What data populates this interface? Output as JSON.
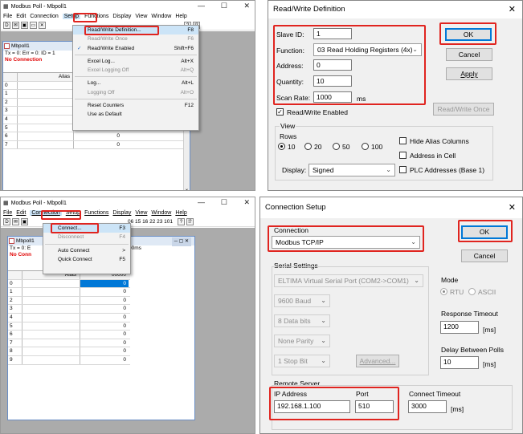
{
  "app": {
    "title": "Modbus Poll - Mbpoll1",
    "menu": [
      "File",
      "Edit",
      "Connection",
      "Setup",
      "Functions",
      "Display",
      "View",
      "Window",
      "Help"
    ],
    "minimize": "—",
    "maximize": "☐",
    "close": "✕",
    "toolbar": [
      "D",
      "✉",
      "▣",
      "✕",
      "▭",
      "06",
      "15",
      "16",
      "22",
      "23",
      "101",
      "?",
      "⁉"
    ],
    "toolbar_text": "06  15  16  22  23  101"
  },
  "child": {
    "title": "Mbpoll1",
    "status_tl": "Tx = 0: Err = 0: ID = 1",
    "status_bl": "Tx = 0: E",
    "status_ms": "00ms",
    "no_connection": "No Connection",
    "no_connection_short": "No Conn",
    "alias_header": "Alias",
    "value_header": "00000",
    "rows": [
      "0",
      "1",
      "2",
      "3",
      "4",
      "5",
      "6",
      "7",
      "8",
      "9"
    ],
    "values": [
      "0",
      "0",
      "0",
      "0",
      "0",
      "0",
      "0",
      "0",
      "0",
      "0"
    ]
  },
  "setup_menu": {
    "items": [
      {
        "label": "Read/Write Definition...",
        "shortcut": "F8"
      },
      {
        "label": "Read/Write Once",
        "shortcut": "F6"
      },
      {
        "label": "Read/Write Enabled",
        "shortcut": "Shift+F6"
      },
      {
        "label": "Excel Log...",
        "shortcut": "Alt+X"
      },
      {
        "label": "Excel Logging Off",
        "shortcut": "Alt+Q"
      },
      {
        "label": "Log...",
        "shortcut": "Alt+L"
      },
      {
        "label": "Logging Off",
        "shortcut": "Alt+O"
      },
      {
        "label": "Reset Counters",
        "shortcut": "F12"
      },
      {
        "label": "Use as Default",
        "shortcut": ""
      }
    ],
    "check": "✓"
  },
  "connection_menu": {
    "items": [
      {
        "label": "Connect...",
        "shortcut": "F3"
      },
      {
        "label": "Disconnect",
        "shortcut": "F4"
      },
      {
        "label": "Auto Connect",
        "shortcut": ">"
      },
      {
        "label": "Quick Connect",
        "shortcut": "F5"
      }
    ]
  },
  "rw_dialog": {
    "title": "Read/Write Definition",
    "slave_id_label": "Slave ID:",
    "slave_id": "1",
    "function_label": "Function:",
    "function_value": "03 Read Holding Registers (4x)",
    "address_label": "Address:",
    "address": "0",
    "quantity_label": "Quantity:",
    "quantity": "10",
    "scan_rate_label": "Scan Rate:",
    "scan_rate": "1000",
    "scan_unit": "ms",
    "rw_enabled_label": "Read/Write Enabled",
    "ok": "OK",
    "cancel": "Cancel",
    "apply": "Apply",
    "rw_once": "Read/Write Once",
    "view_label": "View",
    "rows_label": "Rows",
    "rows_options": [
      "10",
      "20",
      "50",
      "100"
    ],
    "hide_alias": "Hide Alias Columns",
    "address_in_cell": "Address in Cell",
    "plc_addresses": "PLC Addresses (Base 1)",
    "display_label": "Display:",
    "display_value": "Signed"
  },
  "conn_dialog": {
    "title": "Connection Setup",
    "connection_label": "Connection",
    "connection_value": "Modbus TCP/IP",
    "ok": "OK",
    "cancel": "Cancel",
    "serial_label": "Serial Settings",
    "serial_port": "ELTIMA Virtual Serial Port (COM2->COM1)",
    "baud": "9600 Baud",
    "data_bits": "8 Data bits",
    "parity": "None Parity",
    "stop_bit": "1 Stop Bit",
    "advanced": "Advanced...",
    "mode_label": "Mode",
    "rtu": "RTU",
    "ascii": "ASCII",
    "response_timeout_label": "Response Timeout",
    "response_timeout": "1200",
    "ms": "[ms]",
    "delay_label": "Delay Between Polls",
    "delay": "10",
    "remote_label": "Remote Server",
    "ip_label": "IP Address",
    "ip": "192.168.1.100",
    "port_label": "Port",
    "port": "510",
    "connect_timeout_label": "Connect Timeout",
    "connect_timeout": "3000"
  },
  "colors": {
    "highlight_red": "#e0241f",
    "menu_highlight": "#cce4f7",
    "selected_cell": "#0078d7",
    "no_connection": "#e00000"
  }
}
